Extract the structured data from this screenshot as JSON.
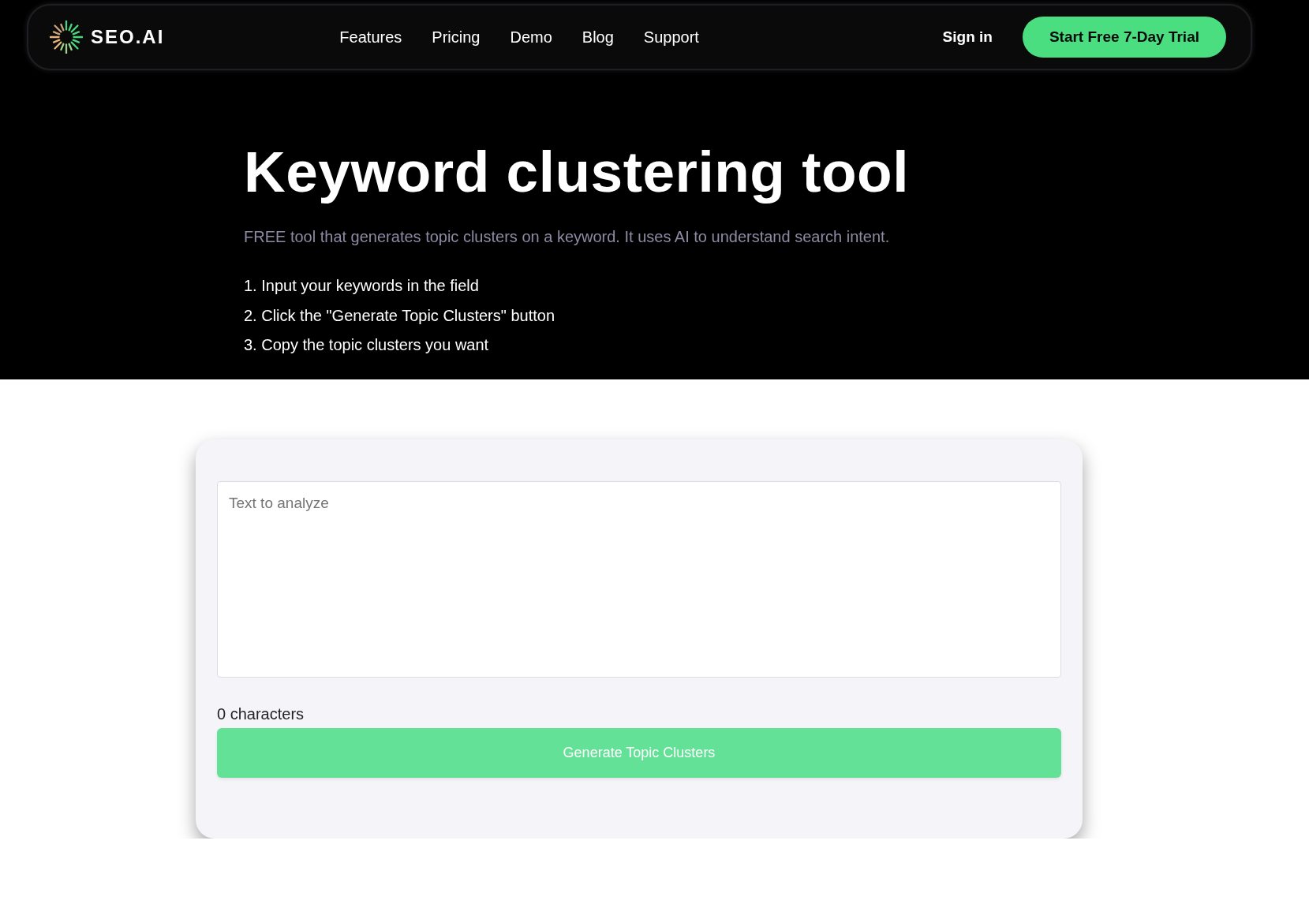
{
  "nav": {
    "logo": {
      "text": "SEO.AI"
    },
    "links": [
      "Features",
      "Pricing",
      "Demo",
      "Blog",
      "Support"
    ],
    "sign_in": "Sign in",
    "cta": "Start Free 7-Day Trial"
  },
  "hero": {
    "title": "Keyword clustering tool",
    "subtitle": "FREE tool that generates topic clusters on a keyword. It uses AI to understand search intent.",
    "steps": [
      "1. Input your keywords in the field",
      "2. Click the \"Generate Topic Clusters\" button",
      "3. Copy the topic clusters you want"
    ]
  },
  "tool": {
    "textarea": {
      "placeholder": "Text to analyze"
    },
    "char_count": "0 characters",
    "submit": "Generate Topic Clusters"
  }
}
